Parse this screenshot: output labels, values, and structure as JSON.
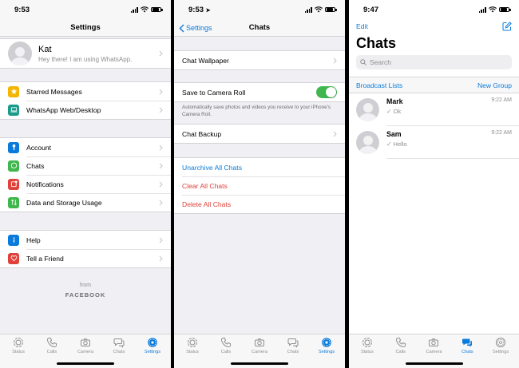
{
  "colors": {
    "accent": "#0a7bdb",
    "toggle_on": "#3fb74c",
    "destructive": "#e0413a"
  },
  "tabs": [
    {
      "label": "Status",
      "icon": "status-icon"
    },
    {
      "label": "Calls",
      "icon": "phone-icon"
    },
    {
      "label": "Camera",
      "icon": "camera-icon"
    },
    {
      "label": "Chats",
      "icon": "chats-icon"
    },
    {
      "label": "Settings",
      "icon": "gear-icon"
    }
  ],
  "settings_screen": {
    "time": "9:53",
    "title": "Settings",
    "profile": {
      "name": "Kat",
      "status": "Hey there! I am using WhatsApp."
    },
    "group1": [
      {
        "label": "Starred Messages",
        "icon": "star-icon",
        "color": "#f4b400"
      },
      {
        "label": "WhatsApp Web/Desktop",
        "icon": "laptop-icon",
        "color": "#1a9b8b"
      }
    ],
    "group2": [
      {
        "label": "Account",
        "icon": "key-icon",
        "color": "#0a7bdb"
      },
      {
        "label": "Chats",
        "icon": "whatsapp-icon",
        "color": "#3fb74c"
      },
      {
        "label": "Notifications",
        "icon": "notification-icon",
        "color": "#e0413a"
      },
      {
        "label": "Data and Storage Usage",
        "icon": "data-arrows-icon",
        "color": "#3fb74c"
      }
    ],
    "group3": [
      {
        "label": "Help",
        "icon": "info-icon",
        "color": "#0a7bdb"
      },
      {
        "label": "Tell a Friend",
        "icon": "heart-icon",
        "color": "#e0413a"
      }
    ],
    "from": "from",
    "brand": "FACEBOOK",
    "active_tab": 4
  },
  "chats_settings_screen": {
    "time": "9:53",
    "back_label": "Settings",
    "title": "Chats",
    "wallpaper": "Chat Wallpaper",
    "save_camera_roll": {
      "label": "Save to Camera Roll",
      "on": true
    },
    "save_note": "Automatically save photos and videos you receive to your iPhone's Camera Roll.",
    "backup": "Chat Backup",
    "unarchive": "Unarchive All Chats",
    "clear": "Clear All Chats",
    "delete": "Delete All Chats",
    "active_tab": 4
  },
  "chats_screen": {
    "time": "9:47",
    "edit": "Edit",
    "title": "Chats",
    "search_placeholder": "Search",
    "broadcast": "Broadcast Lists",
    "new_group": "New Group",
    "chats": [
      {
        "name": "Mark",
        "time": "9:22 AM",
        "message": "✓ Ok"
      },
      {
        "name": "Sam",
        "time": "9:22 AM",
        "message": "✓ Hello"
      }
    ],
    "active_tab": 3
  }
}
